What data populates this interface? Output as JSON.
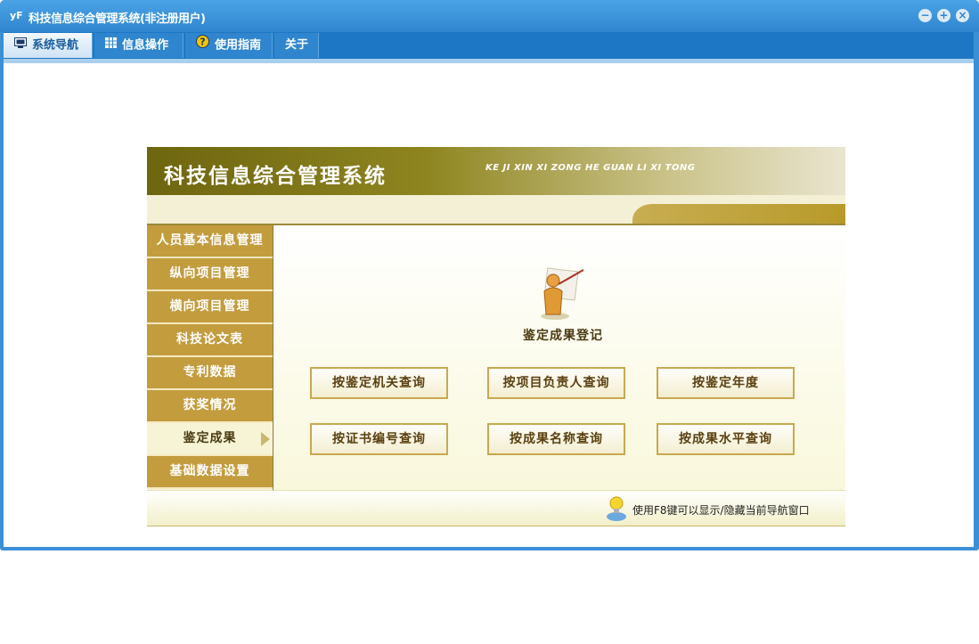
{
  "window": {
    "title": "科技信息综合管理系统(非注册用户)",
    "logo": "yF"
  },
  "menu": {
    "tabs": [
      {
        "label": "系统导航",
        "icon": "monitor-icon"
      },
      {
        "label": "信息操作",
        "icon": "grid-icon"
      },
      {
        "label": "使用指南",
        "icon": "help-icon"
      },
      {
        "label": "关于",
        "icon": ""
      }
    ]
  },
  "banner": {
    "title": "科技信息综合管理系统",
    "subtitle": "KE JI XIN XI ZONG HE GUAN LI XI TONG"
  },
  "sidebar": {
    "items": [
      {
        "label": "人员基本信息管理"
      },
      {
        "label": "纵向项目管理"
      },
      {
        "label": "横向项目管理"
      },
      {
        "label": "科技论文表"
      },
      {
        "label": "专利数据"
      },
      {
        "label": "获奖情况"
      },
      {
        "label": "鉴定成果"
      },
      {
        "label": "基础数据设置"
      }
    ],
    "active_index": 6
  },
  "main": {
    "label": "鉴定成果登记",
    "buttons": [
      {
        "label": "按鉴定机关查询"
      },
      {
        "label": "按项目负责人查询"
      },
      {
        "label": "按鉴定年度"
      },
      {
        "label": "按证书编号查询"
      },
      {
        "label": "按成果名称查询"
      },
      {
        "label": "按成果水平查询"
      }
    ]
  },
  "footer": {
    "hint": "使用F8键可以显示/隐藏当前导航窗口"
  },
  "colors": {
    "titlebar": "#3a8fd6",
    "sidebar_item": "#c39c3e",
    "banner_dark": "#6e6510"
  }
}
